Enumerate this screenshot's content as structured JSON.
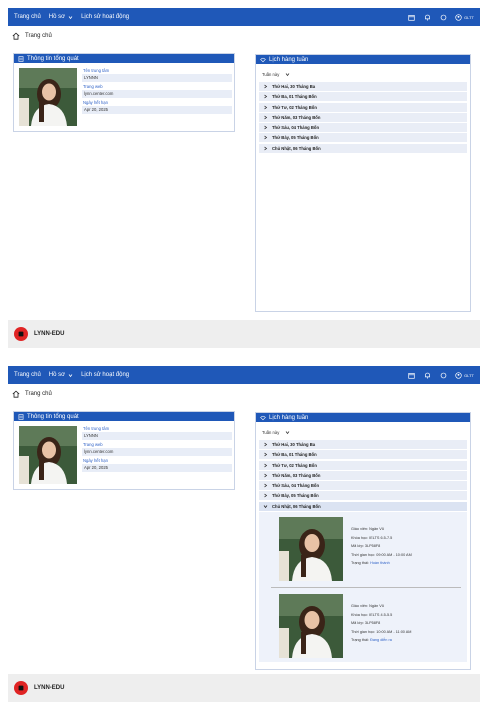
{
  "nav": {
    "home": "Trang chủ",
    "profile": "Hồ sơ",
    "history": "Lịch sử hoạt động",
    "user": "GLTT"
  },
  "breadcrumb": {
    "label": "Trang chủ"
  },
  "overview": {
    "title": "Thông tin tổng quát",
    "fields": [
      {
        "label": "Tên trung tâm",
        "value": "LYNNN"
      },
      {
        "label": "Trang web",
        "value": "lynn.center.com"
      },
      {
        "label": "Ngày hết hạn",
        "value": "Apr 20, 2025"
      }
    ]
  },
  "schedule": {
    "title": "Lịch hàng tuần",
    "week_select": "Tuần này",
    "days": [
      "Thứ Hai, 30 Tháng Ba",
      "Thứ Ba, 01 Tháng Bốn",
      "Thứ Tư, 02 Tháng Bốn",
      "Thứ Năm, 03 Tháng Bốn",
      "Thứ Sáu, 04 Tháng Bốn",
      "Thứ Bảy, 05 Tháng Bốn",
      "Chủ Nhật, 06 Tháng Bốn"
    ],
    "lessons": [
      {
        "teacher": "Giáo viên: Ngân Vũ",
        "course": "Khóa học: IELTS 6.5-7.5",
        "class_code": "Mã lớp: 3LP58F8",
        "time": "Thời gian học: 09:00 AM - 10:00 AM",
        "status_label": "Trạng thái:",
        "status": "Hoàn thành"
      },
      {
        "teacher": "Giáo viên: Ngân Vũ",
        "course": "Khóa học: IELTS 4.5-5.5",
        "class_code": "Mã lớp: 3LP58F8",
        "time": "Thời gian học: 10:00 AM - 11:00 AM",
        "status_label": "Trạng thái:",
        "status": "Đang diễn ra"
      }
    ]
  },
  "footer": {
    "brand": "LYNN-EDU"
  },
  "colors": {
    "primary": "#1f58b8",
    "row_bg": "#e9edf6",
    "footer_bg": "#eeeeee",
    "logo": "#e02424"
  },
  "icons": [
    "calendar-icon",
    "bell-icon",
    "chat-icon",
    "user-circle-icon",
    "home-icon",
    "building-icon",
    "schedule-icon",
    "chevron-right-icon",
    "chevron-down-icon"
  ]
}
